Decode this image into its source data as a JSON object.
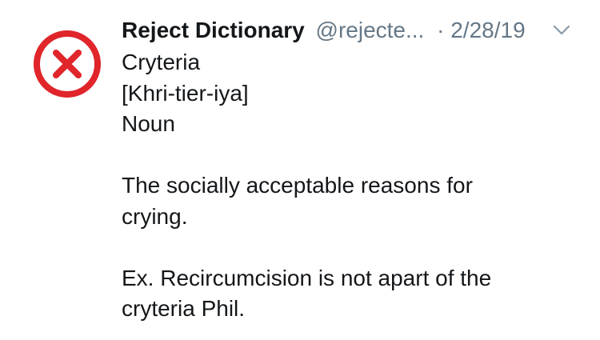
{
  "tweet": {
    "avatar_icon": "red-x-circle-icon",
    "author": {
      "display_name": "Reject Dictionary",
      "handle": "@rejecte..."
    },
    "separator": "·",
    "date": "2/28/19",
    "menu_icon": "chevron-down-icon",
    "lines": [
      "Cryteria",
      "[Khri-tier-iya]",
      "Noun",
      "",
      "The socially acceptable reasons for",
      "crying.",
      "",
      "Ex. Recircumcision is not apart of the",
      "cryteria Phil."
    ]
  },
  "colors": {
    "text": "#14171a",
    "secondary_text": "#657786",
    "avatar_red": "#e0252b",
    "background": "#ffffff"
  }
}
